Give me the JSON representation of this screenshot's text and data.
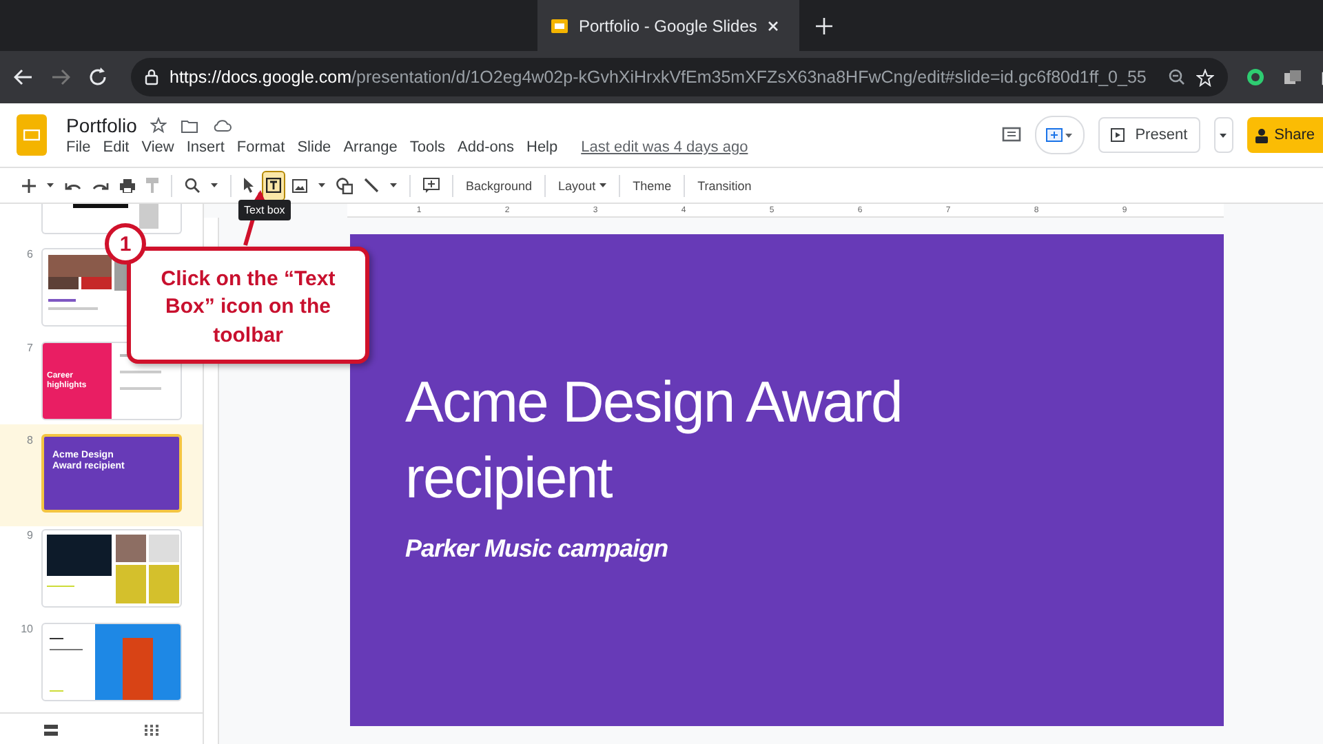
{
  "browser": {
    "tab_title": "Portfolio - Google Slides",
    "url_host": "https://docs.google.com",
    "url_path": "/presentation/d/1O2eg4w02p-kGvhXiHrxkVfEm35mXFZsX63na8HFwCng/edit#slide=id.gc6f80d1ff_0_55"
  },
  "doc": {
    "title": "Portfolio",
    "menu": [
      "File",
      "Edit",
      "View",
      "Insert",
      "Format",
      "Slide",
      "Arrange",
      "Tools",
      "Add-ons",
      "Help"
    ],
    "last_edit": "Last edit was 4 days ago"
  },
  "header_buttons": {
    "present": "Present",
    "share": "Share"
  },
  "toolbar": [
    {
      "kind": "plus"
    },
    {
      "kind": "caret"
    },
    {
      "kind": "undo"
    },
    {
      "kind": "redo"
    },
    {
      "kind": "print"
    },
    {
      "kind": "paint"
    },
    {
      "kind": "sep"
    },
    {
      "kind": "zoom"
    },
    {
      "kind": "caret"
    },
    {
      "kind": "sep"
    },
    {
      "kind": "pointer"
    },
    {
      "kind": "textbox",
      "selected": true
    },
    {
      "kind": "image"
    },
    {
      "kind": "caret"
    },
    {
      "kind": "shape"
    },
    {
      "kind": "line"
    },
    {
      "kind": "caret"
    },
    {
      "kind": "sep"
    },
    {
      "kind": "comment"
    },
    {
      "kind": "sep"
    },
    {
      "kind": "text",
      "label": "Background"
    },
    {
      "kind": "sep"
    },
    {
      "kind": "menu",
      "label": "Layout"
    },
    {
      "kind": "sep"
    },
    {
      "kind": "text",
      "label": "Theme"
    },
    {
      "kind": "sep"
    },
    {
      "kind": "text",
      "label": "Transition"
    }
  ],
  "tooltip": "Text box",
  "ruler": [
    "1",
    "2",
    "3",
    "4",
    "5",
    "6",
    "7",
    "8",
    "9"
  ],
  "slides": [
    {
      "kind": "cut",
      "selected": false
    },
    {
      "number": "6",
      "kind": "photos",
      "selected": false
    },
    {
      "number": "7",
      "kind": "split",
      "title": "Career highlights",
      "color": "#e91e63",
      "selected": false
    },
    {
      "number": "8",
      "kind": "title",
      "title": "Acme Design Award recipient",
      "color": "#673ab7",
      "selected": true
    },
    {
      "number": "9",
      "kind": "gallery",
      "selected": false
    },
    {
      "number": "10",
      "kind": "photo-right",
      "selected": false
    }
  ],
  "slide": {
    "title": "Acme Design Award recipient",
    "subtitle": "Parker Music campaign",
    "color": "#673ab7"
  },
  "callout": {
    "step": "1",
    "text": "Click on the “Text Box” icon on the toolbar"
  }
}
